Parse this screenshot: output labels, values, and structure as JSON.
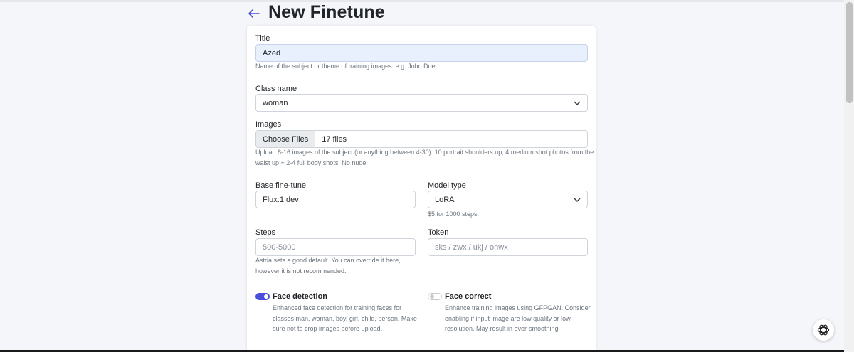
{
  "page": {
    "title": "New Finetune"
  },
  "form": {
    "title": {
      "label": "Title",
      "value": "Azed",
      "help": "Name of the subject or theme of training images. e.g: John Doe"
    },
    "class_name": {
      "label": "Class name",
      "value": "woman"
    },
    "images": {
      "label": "Images",
      "button": "Choose Files",
      "value": "17 files",
      "help_line1": "Upload 8-16 images of the subject (or anything between 4-30). 10 portrait shoulders up, 4 medium shot photos from the",
      "help_line2": "waist up + 2-4 full body shots. No nude."
    },
    "base_finetune": {
      "label": "Base fine-tune",
      "value": "Flux.1 dev"
    },
    "model_type": {
      "label": "Model type",
      "value": "LoRA",
      "help": "$5 for 1000 steps."
    },
    "steps": {
      "label": "Steps",
      "placeholder": "500-5000",
      "help_line1": "Astria sets a good default. You can override it here,",
      "help_line2": "however it is not recommended."
    },
    "token": {
      "label": "Token",
      "placeholder": "sks / zwx / ukj / ohwx"
    },
    "face_detection": {
      "label": "Face detection",
      "enabled": true,
      "help_line1": "Enhanced face detection for training faces for",
      "help_line2": "classes man, woman, boy, girl, child, person. Make",
      "help_line3": "sure not to crop images before upload."
    },
    "face_correct": {
      "label": "Face correct",
      "enabled": false,
      "help_line1": "Enhance training images using GFPGAN. Consider",
      "help_line2": "enabling if input image are low quality or low",
      "help_line3": "resolution. May result in over-smoothing"
    }
  },
  "icons": {
    "back": "arrow-left-icon",
    "dropdown": "chevron-down-icon",
    "assistant": "openai-logo-icon"
  },
  "colors": {
    "accent": "#4a50d8",
    "autofill": "#e8f0fe"
  }
}
